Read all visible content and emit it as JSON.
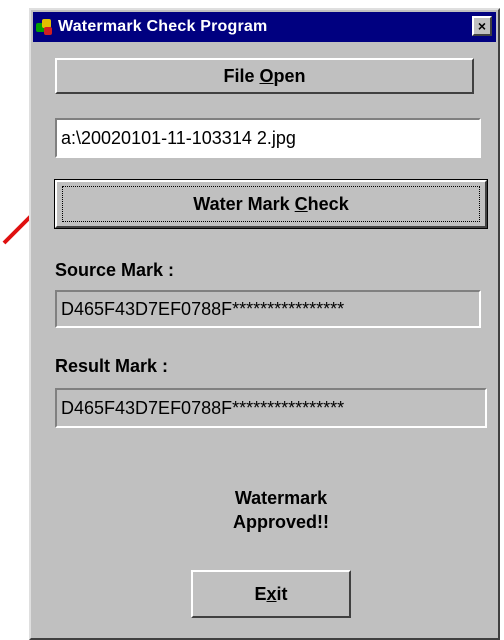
{
  "window": {
    "title": "Watermark Check Program",
    "close_label": "×"
  },
  "file_open_button": {
    "prefix": "File ",
    "mnemonic": "O",
    "suffix": "pen"
  },
  "file_path_field": {
    "value": "a:\\20020101-11-103314 2.jpg"
  },
  "watermark_check_button": {
    "prefix": "Water Mark ",
    "mnemonic": "C",
    "suffix": "heck"
  },
  "source_mark": {
    "label": "Source Mark :",
    "value": "D465F43D7EF0788F****************"
  },
  "result_mark": {
    "label": "Result Mark  :",
    "value": "D465F43D7EF0788F****************"
  },
  "status": {
    "line1": "Watermark",
    "line2": "Approved!!"
  },
  "exit_button": {
    "prefix": "E",
    "mnemonic": "x",
    "suffix": "it"
  },
  "colors": {
    "face": "#c0c0c0",
    "titlebar": "#000080",
    "annotation_arrow": "#e01010"
  },
  "icons": {
    "app": "app-icon",
    "close": "close-icon",
    "pointer": "red-arrow-icon"
  }
}
